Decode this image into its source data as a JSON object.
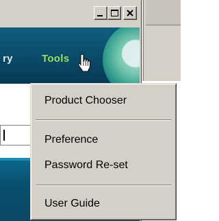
{
  "window": {
    "caption_buttons": {
      "minimize_icon": "minimize-icon",
      "maximize_icon": "maximize-icon",
      "close_icon": "close-icon"
    }
  },
  "nav": {
    "items": [
      {
        "label": "ry"
      },
      {
        "label": "Tools"
      }
    ],
    "active_color": "#9be05a"
  },
  "context_menu": {
    "items": [
      {
        "label": "Product Chooser"
      },
      {
        "label": "Preference"
      },
      {
        "label": "Password Re-set"
      },
      {
        "label": "User Guide"
      }
    ]
  },
  "cursor": {
    "icon": "hand-pointer-icon"
  }
}
